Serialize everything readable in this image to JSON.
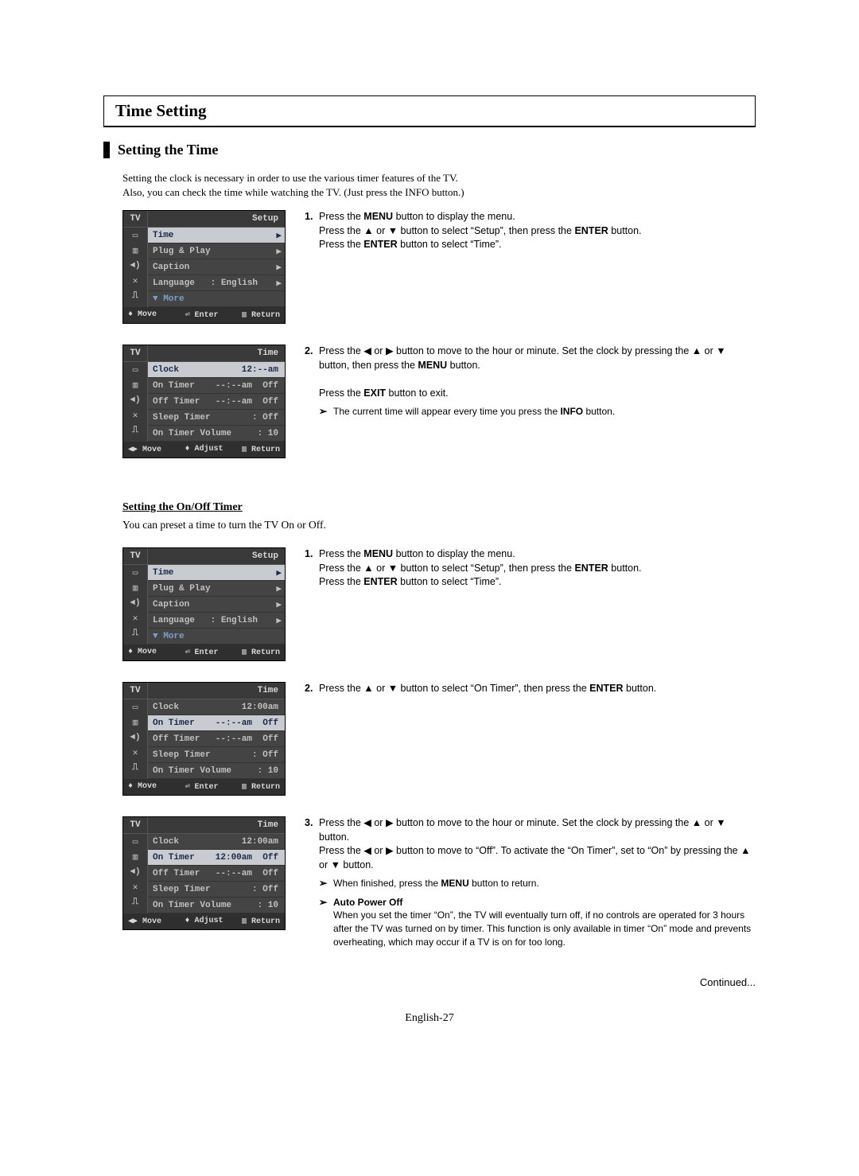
{
  "title": "Time Setting",
  "section1": {
    "heading": "Setting the Time",
    "intro1": "Setting the clock is necessary in order to use the various timer features of the TV.",
    "intro2": "Also, you can check the time while watching the TV. (Just press the INFO button.)"
  },
  "osd_setup": {
    "tv": "TV",
    "title": "Setup",
    "time": "Time",
    "plug": "Plug & Play",
    "caption": "Caption",
    "language_l": "Language",
    "language_v": ": English",
    "more": "▼ More",
    "foot_move": "Move",
    "foot_enter": "Enter",
    "foot_return": "Return"
  },
  "osd_time1": {
    "tv": "TV",
    "title": "Time",
    "clock_l": "Clock",
    "clock_v": "12:--am",
    "ontimer_l": "On Timer",
    "ontimer_v": "--:--am  Off",
    "offtimer_l": "Off Timer",
    "offtimer_v": "--:--am  Off",
    "sleep_l": "Sleep Timer",
    "sleep_v": ": Off",
    "vol_l": "On Timer Volume",
    "vol_v": ": 10",
    "foot_move": "Move",
    "foot_adjust": "Adjust",
    "foot_return": "Return"
  },
  "step1_a": "Press the ",
  "step1_b": "MENU",
  "step1_c": " button to display the menu.",
  "step1_d": "Press the ▲ or ▼ button to select “Setup”, then press the ",
  "step1_e": "ENTER",
  "step1_f": " button.",
  "step1_g": "Press the ",
  "step1_h": "ENTER",
  "step1_i": " button to select “Time”.",
  "step2_a": "Press the ◀ or ▶ button to move to the hour or minute. Set the clock by pressing the ▲ or ▼ button, then press the ",
  "step2_b": "MENU",
  "step2_c": " button.",
  "step2_d": "Press the ",
  "step2_e": "EXIT",
  "step2_f": " button to exit.",
  "step2_note": "The current time will appear every time you press the ",
  "step2_note_b": "INFO",
  "step2_note_c": " button.",
  "section2": {
    "heading": "Setting the On/Off Timer",
    "desc": "You can preset a time to turn the TV On or Off."
  },
  "osd_time2": {
    "title": "Time",
    "clock_v": "12:00am",
    "ontimer_v": "--:--am  Off",
    "offtimer_v": "--:--am  Off",
    "foot_enter": "Enter"
  },
  "osd_time3": {
    "title": "Time",
    "clock_v": "12:00am",
    "ontimer_v": "12:00am  Off",
    "offtimer_v": "--:--am  Off",
    "foot_adjust": "Adjust"
  },
  "s2_step2": "Press the ▲ or ▼ button to select “On Timer”, then press the ",
  "s2_step2_b": "ENTER",
  "s2_step2_c": " button.",
  "s2_step3_a": "Press the ◀ or ▶ button to move to the hour or minute. Set the clock by pressing the ▲ or ▼ button.",
  "s2_step3_b": "Press the ◀ or ▶ button to move to “Off”. To activate the “On Timer”, set to “On” by pressing the ▲ or ▼ button.",
  "s2_note1": "When finished, press the ",
  "s2_note1_b": "MENU",
  "s2_note1_c": " button to return.",
  "s2_note2_h": "Auto Power Off",
  "s2_note2": "When you set the timer “On”, the TV will eventually turn off, if no controls are operated for 3 hours after the TV was turned on by timer. This function is only available in timer “On” mode and prevents overheating, which may occur if a TV is on for too long.",
  "continued": "Continued...",
  "pagefoot": "English-27"
}
